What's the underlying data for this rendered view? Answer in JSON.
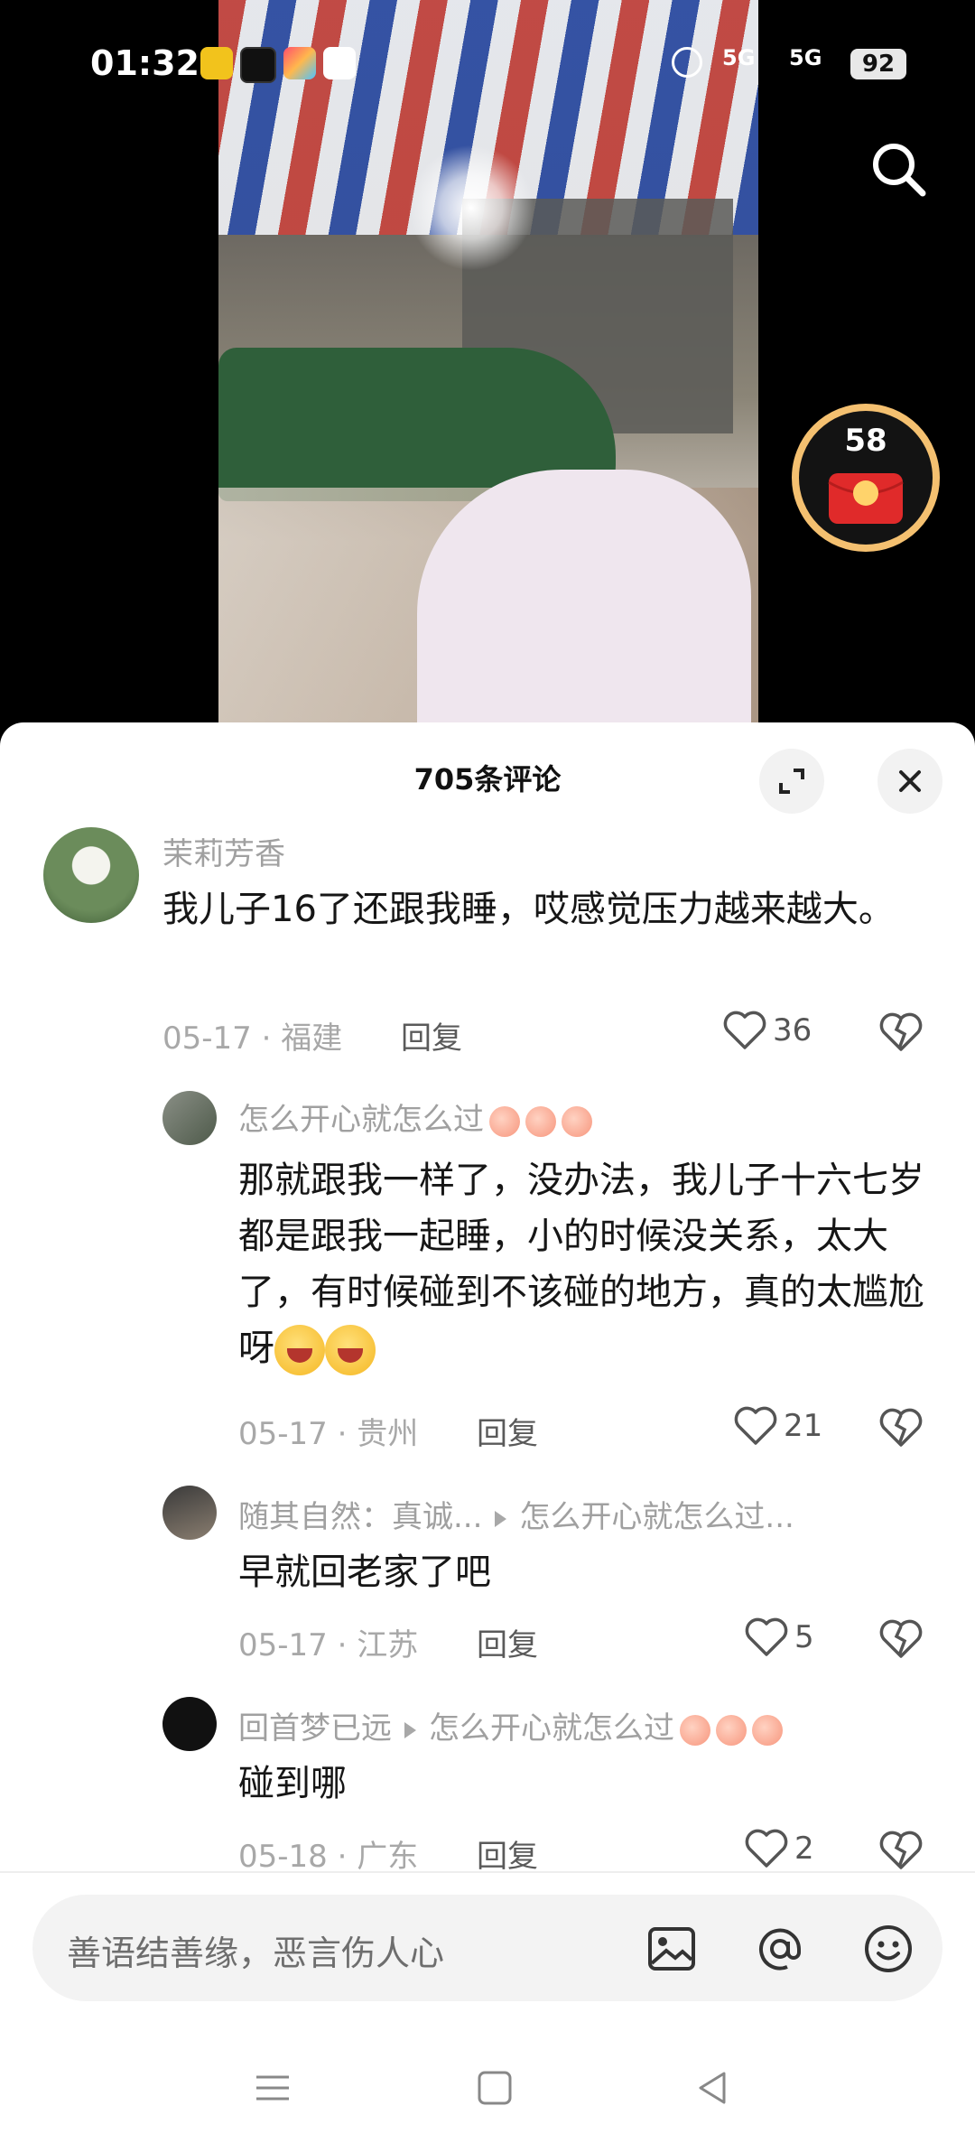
{
  "status_bar": {
    "time": "01:32",
    "signal_1": "5G",
    "signal_2": "5G",
    "battery": "92",
    "icons": [
      "58-app-icon",
      "tiktok-icon",
      "app-icon",
      "app-icon",
      "alarm-icon",
      "signal-icon",
      "signal-icon",
      "battery-icon"
    ]
  },
  "video": {
    "search_icon": "search-icon",
    "red_packet_count": "58"
  },
  "comments_panel": {
    "title": "705条评论",
    "expand_icon": "expand-icon",
    "close_icon": "close-icon"
  },
  "comments": [
    {
      "user": "茉莉芳香",
      "text": "我儿子16了还跟我睡，哎感觉压力越来越大。",
      "date": "05-17",
      "location": "福建",
      "reply_label": "回复",
      "likes": "36"
    }
  ],
  "replies": [
    {
      "user": "怎么开心就怎么过",
      "text": "那就跟我一样了，没办法，我儿子十六七岁都是跟我一起睡，小的时候没关系，太大了，有时候碰到不该碰的地方，真的太尴尬呀",
      "date": "05-17",
      "location": "贵州",
      "reply_label": "回复",
      "likes": "21"
    },
    {
      "user": "随其自然：真诚...",
      "reply_to": "怎么开心就怎么过...",
      "text": "早就回老家了吧",
      "date": "05-17",
      "location": "江苏",
      "reply_label": "回复",
      "likes": "5"
    },
    {
      "user": "回首梦已远",
      "reply_to": "怎么开心就怎么过",
      "text": "碰到哪",
      "date": "05-18",
      "location": "广东",
      "reply_label": "回复",
      "likes": "2"
    }
  ],
  "input": {
    "placeholder": "善语结善缘，恶言伤人心",
    "icons": [
      "image-icon",
      "at-icon",
      "emoji-icon"
    ]
  },
  "nav": {
    "icons": [
      "menu-icon",
      "home-icon",
      "back-icon"
    ]
  },
  "colors": {
    "accent_red": "#e02a2a",
    "text_secondary": "#a0a0a0"
  }
}
